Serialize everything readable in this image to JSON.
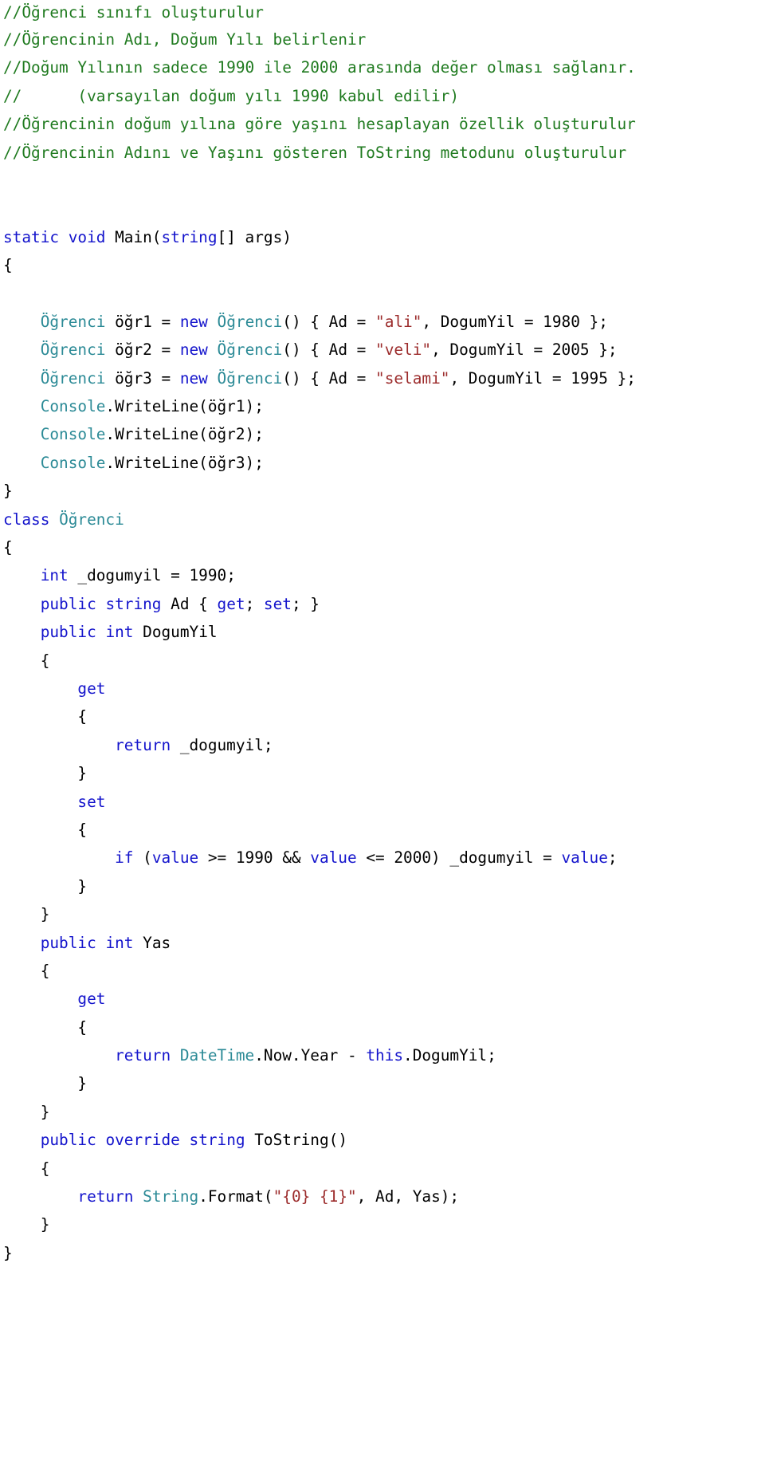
{
  "document": {
    "language": "C#",
    "title": "Ogrenci sinifi code listing",
    "background_color": "#ffffff",
    "colors": {
      "comment": "#1f7a1f",
      "keyword": "#1414cc",
      "type": "#2b8a96",
      "string": "#9c2c2c",
      "plain": "#000000"
    }
  },
  "lines": [
    {
      "indent": 0,
      "tokens": [
        {
          "t": "comment",
          "v": "//Öğrenci sınıfı oluşturulur"
        }
      ]
    },
    {
      "indent": 0,
      "tokens": [
        {
          "t": "comment",
          "v": "//Öğrencinin Adı, Doğum Yılı belirlenir"
        }
      ]
    },
    {
      "indent": 0,
      "tokens": [
        {
          "t": "comment",
          "v": "//Doğum Yılının sadece 1990 ile 2000 arasında değer olması sağlanır."
        }
      ]
    },
    {
      "indent": 0,
      "tokens": [
        {
          "t": "comment",
          "v": "//      (varsayılan doğum yılı 1990 kabul edilir)"
        }
      ]
    },
    {
      "indent": 0,
      "tokens": [
        {
          "t": "comment",
          "v": "//Öğrencinin doğum yılına göre yaşını hesaplayan özellik oluşturulur"
        }
      ]
    },
    {
      "indent": 0,
      "tokens": [
        {
          "t": "comment",
          "v": "//Öğrencinin Adını ve Yaşını gösteren ToString metodunu oluşturulur"
        }
      ]
    },
    {
      "indent": 0,
      "tokens": []
    },
    {
      "indent": 0,
      "tokens": []
    },
    {
      "indent": 0,
      "tokens": [
        {
          "t": "keyword",
          "v": "static"
        },
        {
          "t": "plain",
          "v": " "
        },
        {
          "t": "keyword",
          "v": "void"
        },
        {
          "t": "plain",
          "v": " Main("
        },
        {
          "t": "keyword",
          "v": "string"
        },
        {
          "t": "plain",
          "v": "[] args)"
        }
      ]
    },
    {
      "indent": 0,
      "tokens": [
        {
          "t": "plain",
          "v": "{"
        }
      ]
    },
    {
      "indent": 0,
      "tokens": []
    },
    {
      "indent": 0,
      "tokens": [
        {
          "t": "type",
          "v": "    Öğrenci"
        },
        {
          "t": "plain",
          "v": " öğr1 = "
        },
        {
          "t": "keyword",
          "v": "new"
        },
        {
          "t": "plain",
          "v": " "
        },
        {
          "t": "type",
          "v": "Öğrenci"
        },
        {
          "t": "plain",
          "v": "() { Ad = "
        },
        {
          "t": "string",
          "v": "\"ali\""
        },
        {
          "t": "plain",
          "v": ", DogumYil = 1980 };"
        }
      ]
    },
    {
      "indent": 0,
      "tokens": [
        {
          "t": "type",
          "v": "    Öğrenci"
        },
        {
          "t": "plain",
          "v": " öğr2 = "
        },
        {
          "t": "keyword",
          "v": "new"
        },
        {
          "t": "plain",
          "v": " "
        },
        {
          "t": "type",
          "v": "Öğrenci"
        },
        {
          "t": "plain",
          "v": "() { Ad = "
        },
        {
          "t": "string",
          "v": "\"veli\""
        },
        {
          "t": "plain",
          "v": ", DogumYil = 2005 };"
        }
      ]
    },
    {
      "indent": 0,
      "tokens": [
        {
          "t": "type",
          "v": "    Öğrenci"
        },
        {
          "t": "plain",
          "v": " öğr3 = "
        },
        {
          "t": "keyword",
          "v": "new"
        },
        {
          "t": "plain",
          "v": " "
        },
        {
          "t": "type",
          "v": "Öğrenci"
        },
        {
          "t": "plain",
          "v": "() { Ad = "
        },
        {
          "t": "string",
          "v": "\"selami\""
        },
        {
          "t": "plain",
          "v": ", DogumYil = 1995 };"
        }
      ]
    },
    {
      "indent": 0,
      "tokens": [
        {
          "t": "type",
          "v": "    Console"
        },
        {
          "t": "plain",
          "v": ".WriteLine(öğr1);"
        }
      ]
    },
    {
      "indent": 0,
      "tokens": [
        {
          "t": "type",
          "v": "    Console"
        },
        {
          "t": "plain",
          "v": ".WriteLine(öğr2);"
        }
      ]
    },
    {
      "indent": 0,
      "tokens": [
        {
          "t": "type",
          "v": "    Console"
        },
        {
          "t": "plain",
          "v": ".WriteLine(öğr3);"
        }
      ]
    },
    {
      "indent": 0,
      "tokens": [
        {
          "t": "plain",
          "v": "}"
        }
      ]
    },
    {
      "indent": 0,
      "tokens": [
        {
          "t": "keyword",
          "v": "class"
        },
        {
          "t": "plain",
          "v": " "
        },
        {
          "t": "type",
          "v": "Öğrenci"
        }
      ]
    },
    {
      "indent": 0,
      "tokens": [
        {
          "t": "plain",
          "v": "{"
        }
      ]
    },
    {
      "indent": 0,
      "tokens": [
        {
          "t": "keyword",
          "v": "    int"
        },
        {
          "t": "plain",
          "v": " _dogumyil = 1990;"
        }
      ]
    },
    {
      "indent": 0,
      "tokens": [
        {
          "t": "keyword",
          "v": "    public"
        },
        {
          "t": "plain",
          "v": " "
        },
        {
          "t": "keyword",
          "v": "string"
        },
        {
          "t": "plain",
          "v": " Ad { "
        },
        {
          "t": "keyword",
          "v": "get"
        },
        {
          "t": "plain",
          "v": "; "
        },
        {
          "t": "keyword",
          "v": "set"
        },
        {
          "t": "plain",
          "v": "; }"
        }
      ]
    },
    {
      "indent": 0,
      "tokens": [
        {
          "t": "keyword",
          "v": "    public"
        },
        {
          "t": "plain",
          "v": " "
        },
        {
          "t": "keyword",
          "v": "int"
        },
        {
          "t": "plain",
          "v": " DogumYil"
        }
      ]
    },
    {
      "indent": 0,
      "tokens": [
        {
          "t": "plain",
          "v": "    {"
        }
      ]
    },
    {
      "indent": 0,
      "tokens": [
        {
          "t": "keyword",
          "v": "        get"
        }
      ]
    },
    {
      "indent": 0,
      "tokens": [
        {
          "t": "plain",
          "v": "        {"
        }
      ]
    },
    {
      "indent": 0,
      "tokens": [
        {
          "t": "keyword",
          "v": "            return"
        },
        {
          "t": "plain",
          "v": " _dogumyil;"
        }
      ]
    },
    {
      "indent": 0,
      "tokens": [
        {
          "t": "plain",
          "v": "        }"
        }
      ]
    },
    {
      "indent": 0,
      "tokens": [
        {
          "t": "keyword",
          "v": "        set"
        }
      ]
    },
    {
      "indent": 0,
      "tokens": [
        {
          "t": "plain",
          "v": "        {"
        }
      ]
    },
    {
      "indent": 0,
      "tokens": [
        {
          "t": "keyword",
          "v": "            if"
        },
        {
          "t": "plain",
          "v": " ("
        },
        {
          "t": "keyword",
          "v": "value"
        },
        {
          "t": "plain",
          "v": " >= 1990 && "
        },
        {
          "t": "keyword",
          "v": "value"
        },
        {
          "t": "plain",
          "v": " <= 2000) _dogumyil = "
        },
        {
          "t": "keyword",
          "v": "value"
        },
        {
          "t": "plain",
          "v": ";"
        }
      ]
    },
    {
      "indent": 0,
      "tokens": [
        {
          "t": "plain",
          "v": "        }"
        }
      ]
    },
    {
      "indent": 0,
      "tokens": [
        {
          "t": "plain",
          "v": "    }"
        }
      ]
    },
    {
      "indent": 0,
      "tokens": [
        {
          "t": "keyword",
          "v": "    public"
        },
        {
          "t": "plain",
          "v": " "
        },
        {
          "t": "keyword",
          "v": "int"
        },
        {
          "t": "plain",
          "v": " Yas"
        }
      ]
    },
    {
      "indent": 0,
      "tokens": [
        {
          "t": "plain",
          "v": "    {"
        }
      ]
    },
    {
      "indent": 0,
      "tokens": [
        {
          "t": "keyword",
          "v": "        get"
        }
      ]
    },
    {
      "indent": 0,
      "tokens": [
        {
          "t": "plain",
          "v": "        {"
        }
      ]
    },
    {
      "indent": 0,
      "tokens": [
        {
          "t": "keyword",
          "v": "            return"
        },
        {
          "t": "plain",
          "v": " "
        },
        {
          "t": "type",
          "v": "DateTime"
        },
        {
          "t": "plain",
          "v": ".Now.Year - "
        },
        {
          "t": "keyword",
          "v": "this"
        },
        {
          "t": "plain",
          "v": ".DogumYil;"
        }
      ]
    },
    {
      "indent": 0,
      "tokens": [
        {
          "t": "plain",
          "v": "        }"
        }
      ]
    },
    {
      "indent": 0,
      "tokens": [
        {
          "t": "plain",
          "v": "    }"
        }
      ]
    },
    {
      "indent": 0,
      "tokens": [
        {
          "t": "keyword",
          "v": "    public"
        },
        {
          "t": "plain",
          "v": " "
        },
        {
          "t": "keyword",
          "v": "override"
        },
        {
          "t": "plain",
          "v": " "
        },
        {
          "t": "keyword",
          "v": "string"
        },
        {
          "t": "plain",
          "v": " ToString()"
        }
      ]
    },
    {
      "indent": 0,
      "tokens": [
        {
          "t": "plain",
          "v": "    {"
        }
      ]
    },
    {
      "indent": 0,
      "tokens": [
        {
          "t": "keyword",
          "v": "        return"
        },
        {
          "t": "plain",
          "v": " "
        },
        {
          "t": "type",
          "v": "String"
        },
        {
          "t": "plain",
          "v": ".Format("
        },
        {
          "t": "string",
          "v": "\"{0} {1}\""
        },
        {
          "t": "plain",
          "v": ", Ad, Yas);"
        }
      ]
    },
    {
      "indent": 0,
      "tokens": [
        {
          "t": "plain",
          "v": "    }"
        }
      ]
    },
    {
      "indent": 0,
      "tokens": [
        {
          "t": "plain",
          "v": "}"
        }
      ]
    }
  ]
}
